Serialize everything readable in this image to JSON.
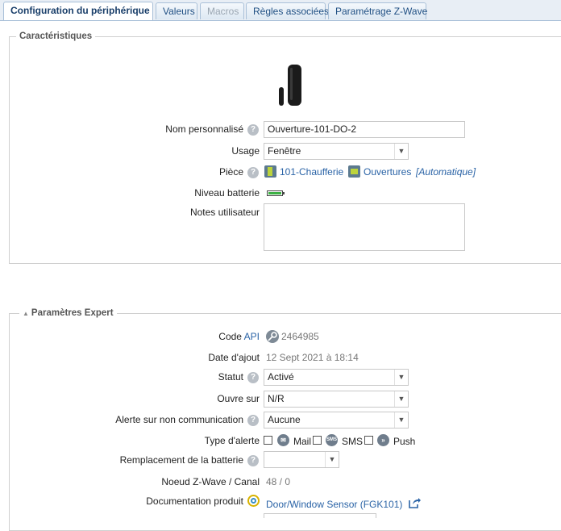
{
  "tabs": [
    {
      "label": "Configuration du périphérique",
      "state": "active"
    },
    {
      "label": "Valeurs",
      "state": "normal"
    },
    {
      "label": "Macros",
      "state": "disabled"
    },
    {
      "label": "Règles associées",
      "state": "normal"
    },
    {
      "label": "Paramétrage Z-Wave",
      "state": "normal"
    }
  ],
  "characteristics": {
    "legend": "Caractéristiques",
    "device_icon": "door-window-sensor-icon",
    "name_label": "Nom personnalisé",
    "name_value": "Ouverture-101-DO-2",
    "usage_label": "Usage",
    "usage_value": "Fenêtre",
    "room_label": "Pièce",
    "room_value": "101-Chaufferie",
    "group_value": "Ouvertures",
    "group_suffix": "[Automatique]",
    "battery_label": "Niveau batterie",
    "notes_label": "Notes utilisateur",
    "notes_value": ""
  },
  "expert": {
    "legend": "Paramètres Expert",
    "code_label": "Code",
    "code_api": "API",
    "code_value": "2464985",
    "date_label": "Date d'ajout",
    "date_value": "12 Sept 2021 à 18:14",
    "status_label": "Statut",
    "status_value": "Activé",
    "opens_label": "Ouvre sur",
    "opens_value": "N/R",
    "alert_label": "Alerte sur non communication",
    "alert_value": "Aucune",
    "alert_type_label": "Type d'alerte",
    "alert_mail": "Mail",
    "alert_sms": "SMS",
    "alert_push": "Push",
    "battery_replace_label": "Remplacement de la batterie",
    "battery_replace_value": "",
    "node_label": "Noeud Z-Wave / Canal",
    "node_value": "48 / 0",
    "doc_label": "Documentation produit",
    "doc_value": "Door/Window Sensor (FGK101)"
  },
  "colors": {
    "link": "#2a63a6",
    "tab_text": "#1f4f83"
  }
}
